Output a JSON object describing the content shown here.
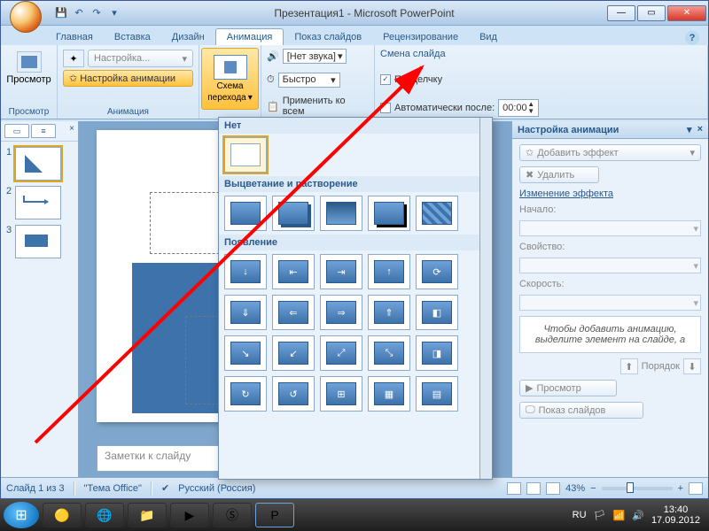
{
  "window": {
    "title": "Презентация1 - Microsoft PowerPoint"
  },
  "qat": {
    "save": "💾",
    "undo": "↶",
    "redo": "↷"
  },
  "tabs": [
    "Главная",
    "Вставка",
    "Дизайн",
    "Анимация",
    "Показ слайдов",
    "Рецензирование",
    "Вид"
  ],
  "active_tab_index": 3,
  "ribbon": {
    "preview_group": "Просмотр",
    "preview_btn": "Просмотр",
    "animation_group": "Анимация",
    "custom_btn": "Настройка...",
    "custom_anim_btn": "Настройка анимации",
    "transition_btn_top": "Схема",
    "transition_btn_bot": "перехода",
    "sound_label": "[Нет звука]",
    "speed_label": "Быстро",
    "apply_all": "Применить ко всем",
    "change_header": "Смена слайда",
    "on_click": "По щелчку",
    "auto_after": "Автоматически после:",
    "auto_time": "00:00"
  },
  "gallery": {
    "none_header": "Нет",
    "fade_header": "Выцветание и растворение",
    "appear_header": "Появление"
  },
  "anim_pane": {
    "title": "Настройка анимации",
    "add_effect": "Добавить эффект",
    "remove": "Удалить",
    "modify_header": "Изменение эффекта",
    "start_lbl": "Начало:",
    "property_lbl": "Свойство:",
    "speed_lbl": "Скорость:",
    "hint": "Чтобы добавить анимацию, выделите элемент на слайде, а",
    "order": "Порядок",
    "preview_btn": "Просмотр",
    "slideshow_btn": "Показ слайдов"
  },
  "slidepane": {
    "thumbs": [
      1,
      2,
      3
    ]
  },
  "notes_placeholder": "Заметки к слайду",
  "status": {
    "slide_of": "Слайд 1 из 3",
    "theme": "\"Тема Office\"",
    "lang": "Русский (Россия)",
    "zoom": "43%"
  },
  "taskbar": {
    "lang": "RU",
    "time": "13:40",
    "date": "17.09.2012"
  }
}
